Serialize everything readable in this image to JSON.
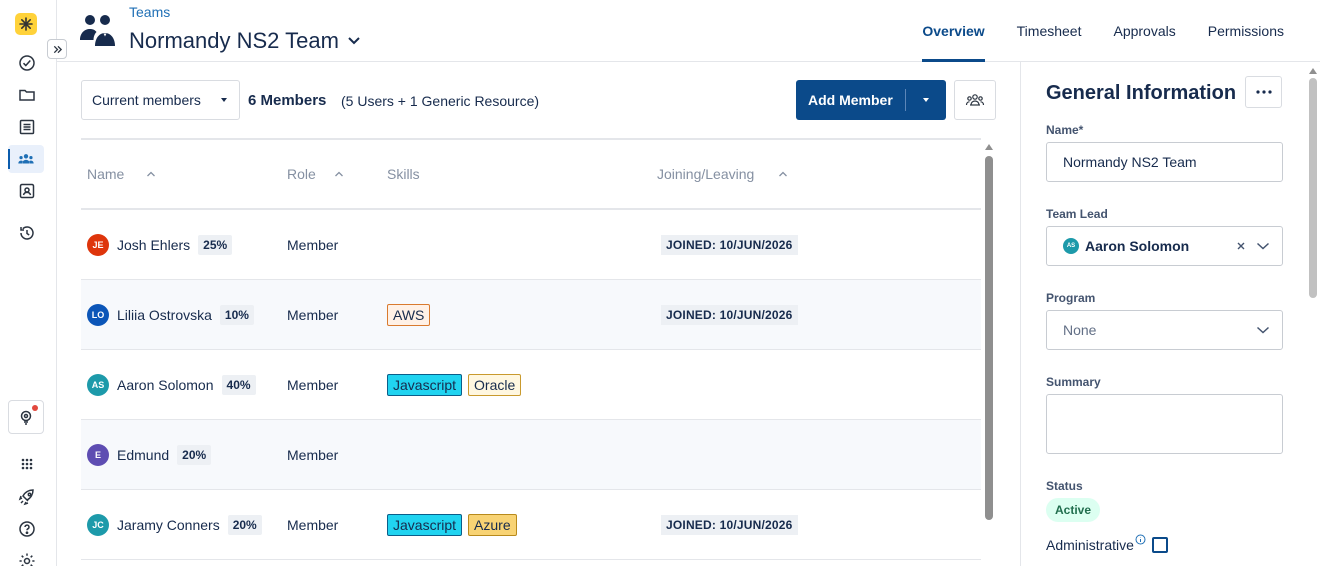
{
  "header": {
    "breadcrumb": "Teams",
    "title": "Normandy NS2 Team",
    "tabs": [
      {
        "label": "Overview",
        "active": true
      },
      {
        "label": "Timesheet",
        "active": false
      },
      {
        "label": "Approvals",
        "active": false
      },
      {
        "label": "Permissions",
        "active": false
      }
    ]
  },
  "rail": {
    "items": [
      "logo-icon",
      "check-circle-icon",
      "folder-icon",
      "list-icon",
      "team-icon",
      "contact-card-icon",
      "history-icon"
    ],
    "bottom": [
      "assistant-icon",
      "apps-grid-icon",
      "rocket-icon",
      "help-icon",
      "settings-icon"
    ]
  },
  "toolbar": {
    "filter_value": "Current members",
    "members_count": "6 Members",
    "members_sub": "(5 Users + 1 Generic Resource)",
    "add_label": "Add Member"
  },
  "table": {
    "columns": [
      "Name",
      "Role",
      "Skills",
      "Joining/Leaving"
    ],
    "rows": [
      {
        "initials": "JE",
        "avatar_color": "#de350b",
        "name": "Josh Ehlers",
        "pct": "25%",
        "role": "Member",
        "skills": [],
        "joined": "JOINED: 10/JUN/2026"
      },
      {
        "initials": "LO",
        "avatar_color": "#0c56b8",
        "name": "Liliia Ostrovska",
        "pct": "10%",
        "role": "Member",
        "skills": [
          {
            "label": "AWS",
            "bg": "#fff1e6",
            "border": "#d97a2e"
          }
        ],
        "joined": "JOINED: 10/JUN/2026"
      },
      {
        "initials": "AS",
        "avatar_color": "#1d9aaa",
        "name": "Aaron Solomon",
        "pct": "40%",
        "role": "Member",
        "skills": [
          {
            "label": "Javascript",
            "bg": "#20d3f0",
            "border": "#0b5e8a"
          },
          {
            "label": "Oracle",
            "bg": "#fff7e0",
            "border": "#c99a2e"
          }
        ],
        "joined": ""
      },
      {
        "initials": "E",
        "avatar_color": "#5e4db2",
        "name": "Edmund",
        "pct": "20%",
        "role": "Member",
        "skills": [],
        "joined": ""
      },
      {
        "initials": "JC",
        "avatar_color": "#1d9aaa",
        "name": "Jaramy Conners",
        "pct": "20%",
        "role": "Member",
        "skills": [
          {
            "label": "Javascript",
            "bg": "#20d3f0",
            "border": "#0b5e8a"
          },
          {
            "label": "Azure",
            "bg": "#f8d374",
            "border": "#b88a1c"
          }
        ],
        "joined": "JOINED: 10/JUN/2026"
      }
    ]
  },
  "side": {
    "title": "General Information",
    "name_label": "Name*",
    "name_value": "Normandy NS2 Team",
    "lead_label": "Team Lead",
    "lead_initials": "AS",
    "lead_value": "Aaron Solomon",
    "program_label": "Program",
    "program_value": "None",
    "summary_label": "Summary",
    "summary_value": "",
    "status_label": "Status",
    "status_value": "Active",
    "admin_label": "Administrative"
  }
}
